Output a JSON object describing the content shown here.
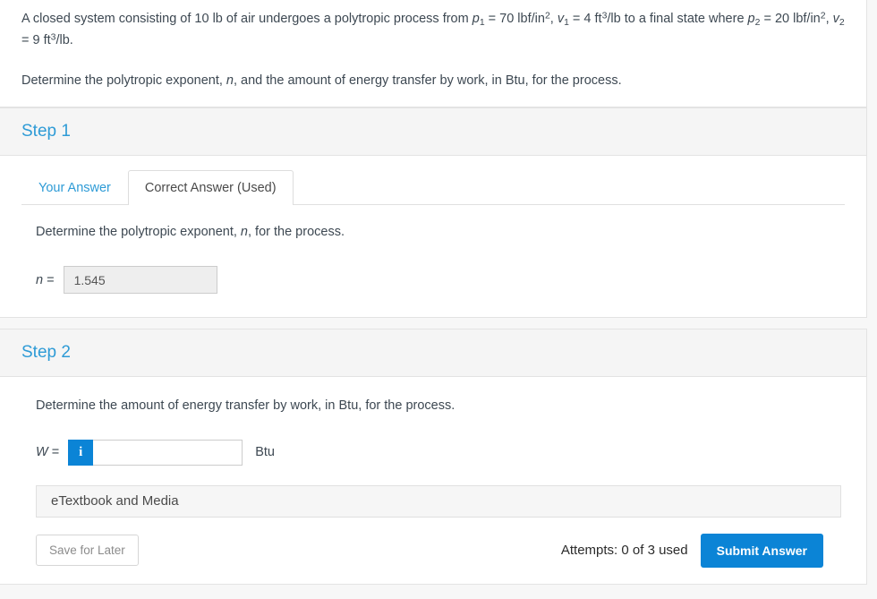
{
  "colors": {
    "accent_blue": "#2e9bd6",
    "button_blue": "#0b84d6",
    "page_background": "#f7f7f7",
    "card_header_gray": "#f5f5f5",
    "disabled_input_gray": "#eeeeee"
  },
  "problem": {
    "line1_part1": "A closed system consisting of 10 lb of air undergoes a polytropic process from ",
    "p1_symbol": "p",
    "p1_sub": "1",
    "p1_value": " = 70 lbf/in",
    "p1_exp": "2",
    "comma1": ", ",
    "v1_symbol": "v",
    "v1_sub": "1",
    "v1_value": " = 4 ft",
    "v1_exp": "3",
    "v1_tail": "/lb to a final state where ",
    "p2_symbol": "p",
    "p2_sub": "2",
    "p2_value": " = 20 lbf/in",
    "p2_exp": "2",
    "comma2": ", ",
    "v2_symbol": "v",
    "v2_sub": "2",
    "v2_value": " = 9 ft",
    "v2_exp": "3",
    "v2_tail": "/lb.",
    "paragraph2_part1": "Determine the polytropic exponent, ",
    "paragraph2_var": "n",
    "paragraph2_part2": ", and the amount of energy transfer by work, in Btu, for the process."
  },
  "step1": {
    "title": "Step 1",
    "tabs": [
      {
        "label": "Your Answer",
        "active": false
      },
      {
        "label": "Correct Answer (Used)",
        "active": true
      }
    ],
    "prompt_part1": "Determine the polytropic exponent, ",
    "prompt_var": "n",
    "prompt_part2": ", for the process.",
    "answer_label_var": "n",
    "answer_label_eq": " =",
    "answer_value": "1.545"
  },
  "step2": {
    "title": "Step 2",
    "prompt": "Determine the amount of energy transfer by work, in Btu, for the process.",
    "answer_label_var": "W",
    "answer_label_eq": " =",
    "info_icon_glyph": "i",
    "input_value": "",
    "input_placeholder": "",
    "unit": "Btu",
    "etextbook_label": "eTextbook and Media",
    "save_label": "Save for Later",
    "attempts_label": "Attempts: 0 of 3 used",
    "submit_label": "Submit Answer"
  }
}
